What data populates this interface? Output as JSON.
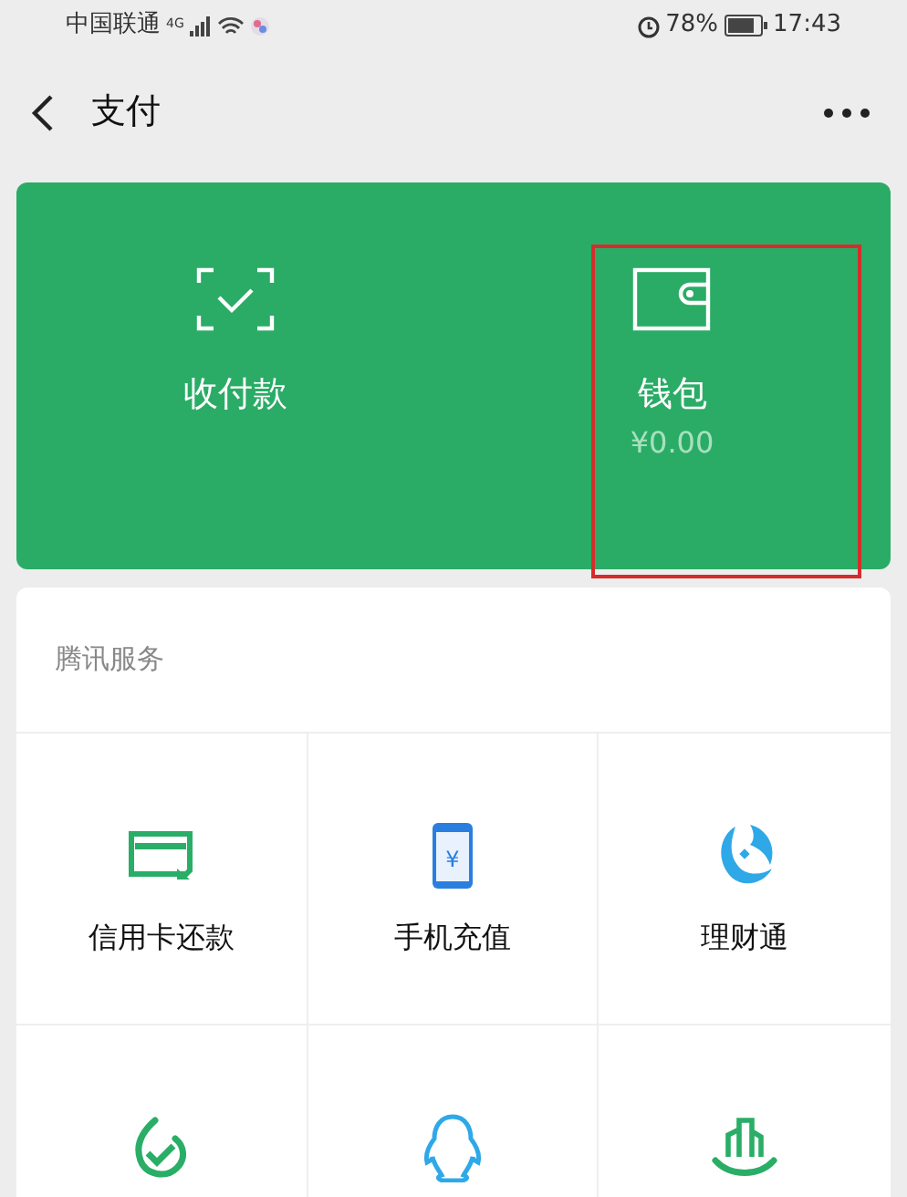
{
  "status_bar": {
    "carrier": "中国联通",
    "network": "4G",
    "battery": "78%",
    "time": "17:43"
  },
  "nav": {
    "title": "支付"
  },
  "pay_card": {
    "items": [
      {
        "label": "收付款"
      },
      {
        "label": "钱包",
        "amount": "¥0.00",
        "highlighted": true
      }
    ]
  },
  "services": {
    "title": "腾讯服务",
    "tiles": [
      {
        "kind": "labeled",
        "label": "信用卡还款"
      },
      {
        "kind": "labeled",
        "label": "手机充值",
        "icon_text": "¥"
      },
      {
        "kind": "labeled",
        "label": "理财通"
      },
      {
        "kind": "icon_only"
      },
      {
        "kind": "icon_only"
      },
      {
        "kind": "icon_only"
      }
    ]
  }
}
